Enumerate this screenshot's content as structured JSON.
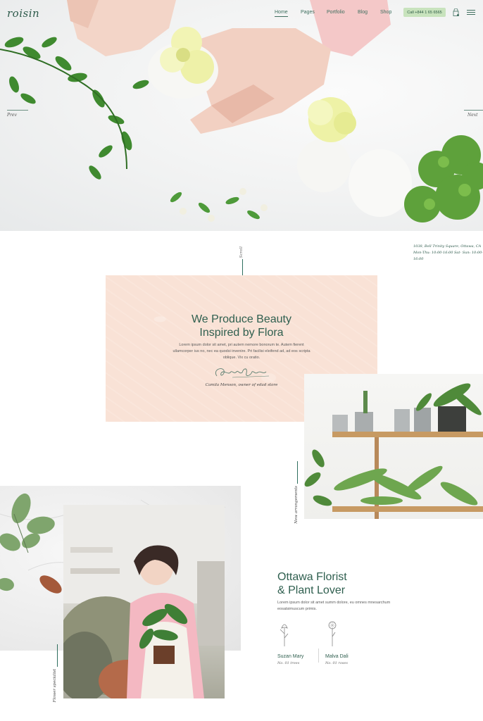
{
  "header": {
    "logo": "roisin",
    "nav": [
      "Home",
      "Pages",
      "Portfolio",
      "Blog",
      "Shop"
    ],
    "call_label": "Call +844 1 65 6565",
    "cart_icon": "shopping-bag-icon",
    "menu_icon": "hamburger-icon"
  },
  "hero": {
    "prev_label": "Prev",
    "next_label": "Next"
  },
  "info": {
    "scroll_label": "Scroll",
    "address_line1": "1038, Bell Trinity Square, Ottawa, CA",
    "address_line2": "Mon-Thu: 10:00-16:00 Sat- Sun: 10:00-16:00"
  },
  "intro": {
    "title_line1": "We Produce Beauty",
    "title_line2": "Inspired by Flora",
    "text": "Lorem ipsum dolor sit amet, pri autem nemore bonorum te. Autem fierent ullamcorper ius no, nec ea quodsi invenire. Pri facilisi eleifend ad, ad eos scripta oblique. Vix cu oratio.",
    "signature_caption": "Camila Menson, owner of edad store",
    "signature_icon": "signature-script",
    "background": "#f9e2d6"
  },
  "arrangements": {
    "label": "New arrangements"
  },
  "florist": {
    "label": "Flower specialist",
    "title_line1": "Ottawa Florist",
    "title_line2": "& Plant Lover",
    "text": "Lorem ipsum dolor sit amet summ dolore, eu omnes mnesarchum eosatsimuscum primis.",
    "members": [
      {
        "name": "Suzan Mary",
        "role": "No. 01 trees",
        "icon": "flower-sketch-icon"
      },
      {
        "name": "Malva Dali",
        "role": "No. 01 roses",
        "icon": "dandelion-sketch-icon"
      }
    ]
  },
  "colors": {
    "accent": "#2f5f4f",
    "call_button": "#c8e3bd",
    "pink_card": "#f9e2d6"
  }
}
